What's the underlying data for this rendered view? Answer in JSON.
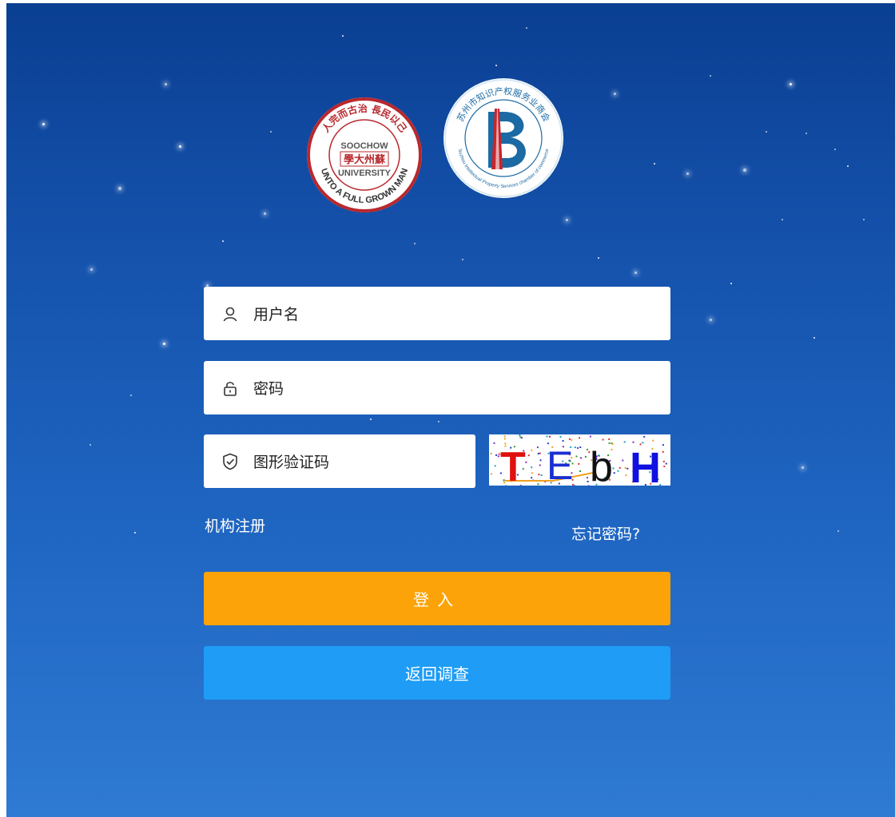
{
  "logos": {
    "left": {
      "top_text": "人完而古治 長民以己",
      "bottom_text": "UNTO A FULL GROWN MAN",
      "center_text": "SOOCHOW UNIVERSITY"
    },
    "right": {
      "top_text": "苏州市知识产权服务业商会",
      "bottom_text": "Suzhou Intellectual Property Services chamber of commerce"
    }
  },
  "login": {
    "username_placeholder": "用户名",
    "password_placeholder": "密码",
    "captcha_placeholder": "图形验证码",
    "captcha_text": "TEbH",
    "register_link": "机构注册",
    "forgot_link": "忘记密码?",
    "login_button": "登入",
    "return_button": "返回调查"
  },
  "colors": {
    "background_top": "#0a3f92",
    "background_bottom": "#2f7ad3",
    "login_button": "#fca309",
    "return_button": "#1e9cf6",
    "logo_left_ring": "#b8282d",
    "logo_right_ring": "#1b6aa4"
  },
  "icons": {
    "username": "user-icon",
    "password": "lock-icon",
    "captcha": "shield-check-icon"
  }
}
